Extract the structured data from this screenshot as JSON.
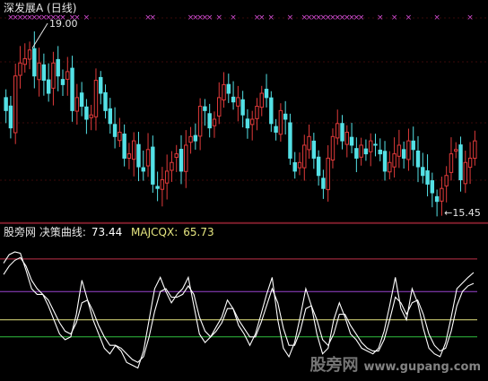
{
  "title": "深发展A (日线)",
  "hi_label": "19.00",
  "lo_label": "15.45",
  "indicator": {
    "name": "股旁网 决策曲线:",
    "value1": "73.44",
    "name2": "MAJCQX:",
    "value2": "65.73"
  },
  "watermark": {
    "cn": "股旁网",
    "url": "www.gupang.com"
  },
  "colors": {
    "up": "#e03a3a",
    "down": "#54e1e6",
    "signal": "#d14cd1",
    "white": "#ffffff",
    "h1": "#c0304a",
    "h2": "#9a45d0",
    "h3": "#e6e680",
    "h4": "#30c040",
    "grid": "#3a0a0a"
  },
  "chart_data": [
    {
      "type": "candlestick",
      "title": "深发展A (日线)",
      "ylim": [
        15.0,
        19.6
      ],
      "annotations": [
        "19.00",
        "15.45"
      ],
      "close": [
        17.5,
        17.1,
        18.3,
        18.6,
        18.7,
        18.9,
        18.3,
        18.6,
        18.2,
        17.9,
        18.6,
        18.3,
        18.1,
        18.4,
        17.5,
        17.8,
        17.6,
        17.3,
        17.4,
        18.2,
        17.9,
        17.5,
        17.2,
        16.9,
        17.0,
        16.4,
        16.5,
        16.8,
        16.2,
        16.1,
        16.6,
        15.8,
        15.7,
        15.9,
        16.1,
        16.3,
        16.5,
        16.1,
        16.7,
        16.9,
        16.8,
        17.6,
        17.5,
        17.1,
        17.3,
        17.8,
        18.1,
        17.9,
        17.7,
        17.8,
        17.4,
        17.1,
        17.3,
        17.6,
        17.9,
        17.8,
        17.2,
        17.0,
        17.5,
        17.3,
        16.4,
        16.1,
        16.3,
        16.7,
        16.9,
        16.4,
        16.0,
        15.7,
        16.4,
        16.9,
        17.2,
        16.8,
        17.0,
        16.7,
        16.4,
        16.7,
        16.5,
        16.8,
        16.7,
        16.5,
        16.1,
        16.3,
        16.5,
        16.7,
        16.4,
        16.8,
        16.6,
        16.2,
        16.0,
        15.8,
        15.6,
        15.4,
        15.7,
        16.0,
        16.5,
        16.6,
        15.9,
        16.3,
        16.4,
        16.8
      ]
    },
    {
      "type": "line",
      "series": [
        {
          "name": "决策曲线",
          "values": [
            80,
            86,
            88,
            87,
            75,
            62,
            58,
            58,
            50,
            40,
            30,
            26,
            28,
            44,
            68,
            54,
            40,
            30,
            20,
            16,
            22,
            18,
            10,
            8,
            6,
            18,
            40,
            62,
            70,
            60,
            52,
            58,
            62,
            70,
            50,
            30,
            24,
            28,
            35,
            42,
            54,
            48,
            36,
            30,
            22,
            30,
            44,
            58,
            70,
            40,
            20,
            14,
            24,
            42,
            62,
            50,
            30,
            16,
            20,
            40,
            52,
            42,
            30,
            26,
            20,
            18,
            16,
            20,
            32,
            50,
            70,
            48,
            40,
            62,
            52,
            34,
            20,
            16,
            14,
            24,
            42,
            62,
            66,
            70,
            73.44
          ]
        },
        {
          "name": "MAJCQX",
          "values": [
            72,
            78,
            82,
            84,
            78,
            68,
            62,
            58,
            54,
            46,
            38,
            32,
            30,
            38,
            52,
            54,
            46,
            36,
            28,
            22,
            22,
            20,
            16,
            12,
            10,
            14,
            28,
            46,
            60,
            62,
            56,
            56,
            58,
            64,
            58,
            42,
            32,
            28,
            32,
            38,
            48,
            48,
            40,
            34,
            28,
            28,
            38,
            50,
            62,
            52,
            34,
            22,
            22,
            32,
            48,
            50,
            40,
            26,
            22,
            30,
            44,
            44,
            36,
            30,
            24,
            20,
            18,
            18,
            26,
            40,
            56,
            52,
            44,
            52,
            54,
            44,
            30,
            22,
            18,
            20,
            32,
            50,
            60,
            64,
            65.73
          ]
        }
      ],
      "reference_lines": [
        83,
        60,
        40,
        28
      ]
    }
  ]
}
